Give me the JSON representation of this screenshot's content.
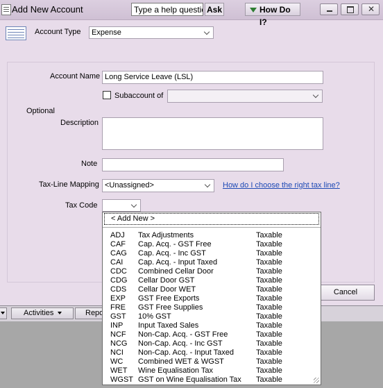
{
  "window": {
    "title": "Add New Account",
    "help_search": "Type a help question",
    "ask_label": "Ask",
    "how_do_i_label": "How Do I?",
    "window_controls": [
      "minimize",
      "maximize",
      "close"
    ]
  },
  "form": {
    "account_type_label": "Account Type",
    "account_type_value": "Expense",
    "account_name_label": "Account Name",
    "account_name_value": "Long Service Leave (LSL)",
    "subaccount_label": "Subaccount of",
    "subaccount_checked": false,
    "optional_label": "Optional",
    "description_label": "Description",
    "description_value": "",
    "note_label": "Note",
    "note_value": "",
    "tax_line_label": "Tax-Line Mapping",
    "tax_line_value": "<Unassigned>",
    "tax_line_help_link": "How do I choose the right tax line?",
    "tax_code_label": "Tax Code",
    "tax_code_value": "",
    "cancel_label": "Cancel"
  },
  "bottom_bar": {
    "activities_label": "Activities",
    "reports_label": "Repo"
  },
  "tax_code_dropdown": {
    "add_new_label": "< Add New >",
    "items": [
      {
        "code": "ADJ",
        "name": "Tax Adjustments",
        "type": "Taxable"
      },
      {
        "code": "CAF",
        "name": "Cap. Acq. - GST Free",
        "type": "Taxable"
      },
      {
        "code": "CAG",
        "name": "Cap. Acq. - Inc GST",
        "type": "Taxable"
      },
      {
        "code": "CAI",
        "name": "Cap. Acq. - Input Taxed",
        "type": "Taxable"
      },
      {
        "code": "CDC",
        "name": "Combined Cellar Door",
        "type": "Taxable"
      },
      {
        "code": "CDG",
        "name": "Cellar Door GST",
        "type": "Taxable"
      },
      {
        "code": "CDS",
        "name": "Cellar Door WET",
        "type": "Taxable"
      },
      {
        "code": "EXP",
        "name": "GST Free Exports",
        "type": "Taxable"
      },
      {
        "code": "FRE",
        "name": "GST Free Supplies",
        "type": "Taxable"
      },
      {
        "code": "GST",
        "name": "10% GST",
        "type": "Taxable"
      },
      {
        "code": "INP",
        "name": "Input Taxed Sales",
        "type": "Taxable"
      },
      {
        "code": "NCF",
        "name": "Non-Cap. Acq. - GST Free",
        "type": "Taxable"
      },
      {
        "code": "NCG",
        "name": "Non-Cap. Acq. - Inc GST",
        "type": "Taxable"
      },
      {
        "code": "NCI",
        "name": "Non-Cap. Acq. - Input Taxed",
        "type": "Taxable"
      },
      {
        "code": "WC",
        "name": "Combined WET & WGST",
        "type": "Taxable"
      },
      {
        "code": "WET",
        "name": "Wine Equalisation Tax",
        "type": "Taxable"
      },
      {
        "code": "WGST",
        "name": "GST on Wine Equalisation Tax",
        "type": "Taxable"
      }
    ]
  }
}
